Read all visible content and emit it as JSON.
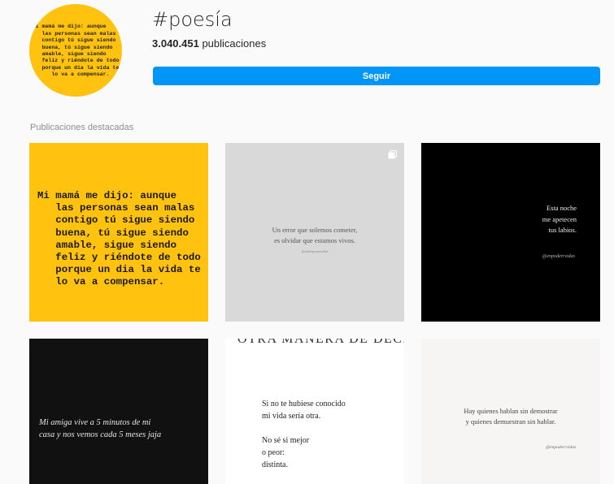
{
  "profile": {
    "avatar_text": "Mi mamá me dijo: aunque\n   las personas sean malas\n   contigo tú sigue siendo\n   buena, tú sigue siendo\n   amable, sigue siendo\n   feliz y riéndote de todo\n   porque un dia la vida te\n      lo va a compensar.",
    "hashtag": "#poesía",
    "post_count": "3.040.451",
    "post_count_suffix": " publicaciones",
    "follow_label": "Seguir"
  },
  "section_label": "Publicaciones destacadas",
  "posts": [
    {
      "text": "Mi mamá me dijo: aunque\n   las personas sean malas\n   contigo tú sigue siendo\n   buena, tú sigue siendo\n   amable, sigue siendo\n   feliz y riéndote de todo\n   porque un dia la vida te\n   lo va a compensar.",
      "bg": "#ffc20e"
    },
    {
      "text": "Un error que solemos cometer,\nes olvidar que estamos vivos.",
      "handle": "@sinhelpoesiasolias",
      "bg": "#d9d9d9",
      "icon": "multiple-posts-icon"
    },
    {
      "text": "Esta noche\nme apetecen\ntus labios.",
      "handle": "@enpoderrvidas",
      "bg": "#000000"
    },
    {
      "text": "Mi amiga vive a 5 minutos de mi\ncasa y nos vemos cada 5 meses jaja",
      "bg": "#111111"
    },
    {
      "header": "OTRA MANERA DE DECIRLO",
      "text": "Si no te hubiese conocido\nmi vida sería otra.\n\nNo sé si mejor\no peor:\ndistinta.\n\nY me gusta mucho",
      "bg": "#ffffff"
    },
    {
      "text": "Hay quienes hablan sin demostrar\ny quienes demuestran sin hablar.",
      "handle": "@enpoderrvidas",
      "bg": "#f7f4f4"
    }
  ]
}
